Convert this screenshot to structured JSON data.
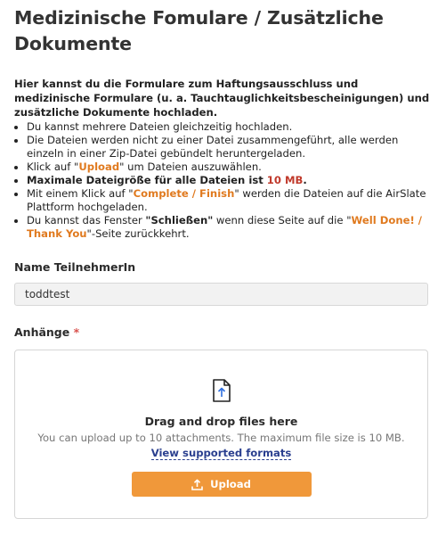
{
  "page": {
    "title": "Medizinische Fomulare / Zusätzliche Dokumente"
  },
  "intro": "Hier kannst du die Formulare zum Haftungsausschluss und medizinische Formulare (u. a. Tauchtauglichkeitsbescheinigungen) und zusätzliche Dokumente hochladen.",
  "bullets": {
    "b1": "Du kannst mehrere Dateien gleichzeitig hochladen.",
    "b2": "Die Dateien werden nicht zu einer Datei zusammengeführt, alle werden einzeln in einer Zip-Datei gebündelt heruntergeladen.",
    "b3_pre": "Klick auf \"",
    "b3_hl": "Upload",
    "b3_post": "\" um Dateien auszuwählen.",
    "b4_text": "Maximale Dateigröße für alle Dateien ist ",
    "b4_hl": "10 MB",
    "b4_post": ".",
    "b5_pre": "Mit einem Klick auf \"",
    "b5_hl": "Complete / Finish",
    "b5_post": "\" werden die Dateien auf die AirSlate Plattform hochgeladen.",
    "b6_pre": "Du kannst das Fenster ",
    "b6_bold": "\"Schließen\"",
    "b6_mid": " wenn diese Seite auf die \"",
    "b6_hl": "Well Done! / Thank You",
    "b6_post": "\"-Seite zurückkehrt."
  },
  "name_field": {
    "label": "Name TeilnehmerIn",
    "value": "toddtest"
  },
  "attachments": {
    "label": "Anhänge",
    "required_mark": "*",
    "title": "Drag and drop files here",
    "info": "You can upload up to 10 attachments.  The maximum file size is 10 MB.",
    "formats_link": "View supported formats",
    "upload_label": "Upload"
  },
  "colors": {
    "accent_orange": "#f0983a",
    "highlight_orange": "#e07a1f",
    "highlight_red": "#c0392b",
    "link_blue": "#2a3f8f"
  },
  "icons": {
    "file": "file-upload-icon",
    "upload": "upload-icon"
  }
}
